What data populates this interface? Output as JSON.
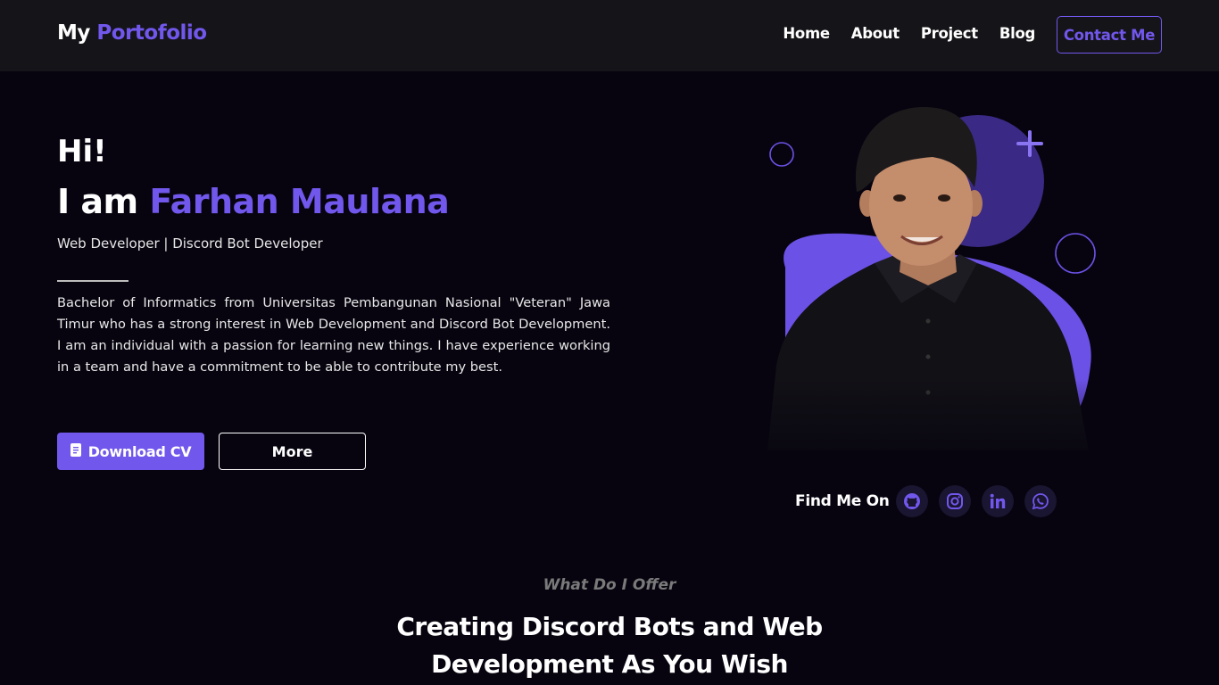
{
  "brand": {
    "prefix": "My",
    "accent": "Portofolio"
  },
  "nav": {
    "links": [
      "Home",
      "About",
      "Project",
      "Blog"
    ],
    "contact_label": "Contact Me"
  },
  "hero": {
    "greeting": "Hi!",
    "intro_prefix": "I am",
    "name": "Farhan Maulana",
    "roles": "Web Developer | Discord Bot Developer",
    "bio": "Bachelor of Informatics from Universitas Pembangunan Nasional \"Veteran\" Jawa Timur who has a strong interest in Web Development and Discord Bot Development. I am an individual with a passion for learning new things. I have experience working in a team and have a commitment to be able to contribute my best.",
    "download_label": "Download CV",
    "more_label": "More",
    "find_me_label": "Find Me On",
    "socials": [
      "github-icon",
      "instagram-icon",
      "linkedin-icon",
      "whatsapp-icon"
    ]
  },
  "offer": {
    "subtitle": "What Do I Offer",
    "title": "Creating Discord Bots and Web Development As You Wish"
  },
  "colors": {
    "accent": "#7257ec",
    "background": "#07040f",
    "navbar": "#151418"
  }
}
